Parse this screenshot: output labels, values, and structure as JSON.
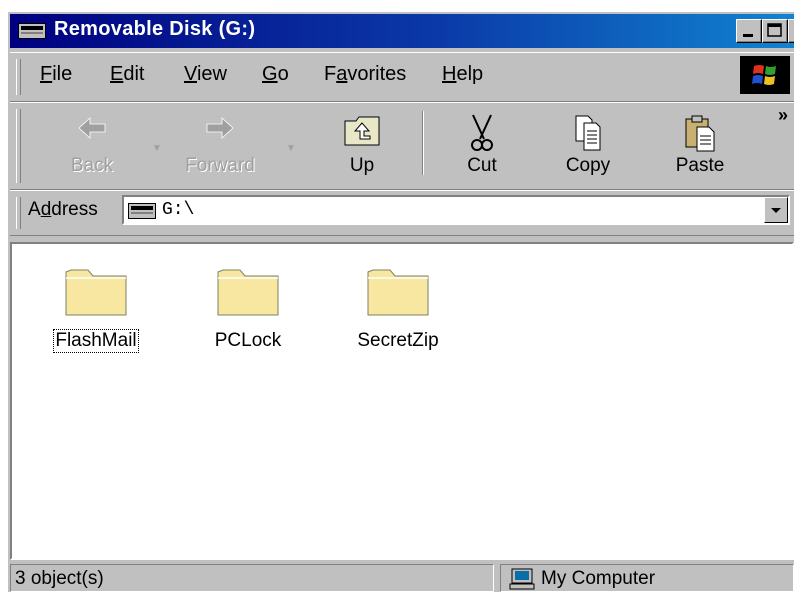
{
  "window": {
    "title": "Removable Disk (G:)",
    "buttons": [
      "minimize",
      "maximize",
      "close"
    ]
  },
  "menu": {
    "items": [
      {
        "key": "F",
        "rest": "ile"
      },
      {
        "key": "E",
        "rest": "dit"
      },
      {
        "key": "V",
        "rest": "iew"
      },
      {
        "key": "G",
        "rest": "o"
      },
      {
        "pre": "F",
        "key": "a",
        "rest": "vorites"
      },
      {
        "key": "H",
        "rest": "elp"
      }
    ]
  },
  "toolbar": {
    "back": "Back",
    "forward": "Forward",
    "up": "Up",
    "cut": "Cut",
    "copy": "Copy",
    "paste": "Paste",
    "more": "»"
  },
  "address": {
    "label_pre": "A",
    "label_key": "d",
    "label_rest": "dress",
    "value": "G:\\"
  },
  "files": [
    {
      "name": "FlashMail",
      "icon": "folder-icon"
    },
    {
      "name": "PCLock",
      "icon": "folder-icon"
    },
    {
      "name": "SecretZip",
      "icon": "folder-icon"
    }
  ],
  "status": {
    "count": "3 object(s)",
    "zone": "My Computer"
  },
  "colors": {
    "title_start": "#000080",
    "title_end": "#1084d0",
    "face": "#c0c0c0",
    "folder": "#f7e7a0"
  }
}
